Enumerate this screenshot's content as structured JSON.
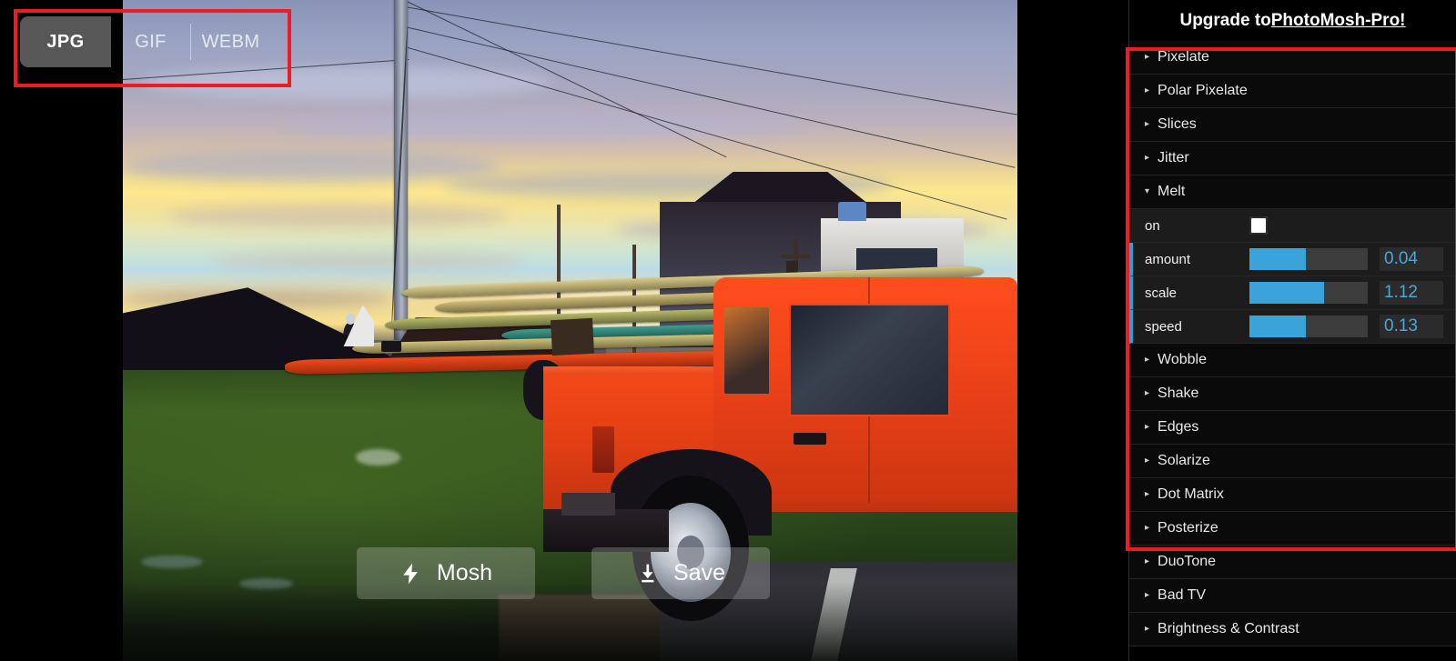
{
  "format_tabs": {
    "items": [
      {
        "label": "JPG",
        "active": true
      },
      {
        "label": "GIF",
        "active": false
      },
      {
        "label": "WEBM",
        "active": false
      }
    ]
  },
  "actions": {
    "mosh": {
      "label": "Mosh",
      "icon": "lightning-bolt-icon"
    },
    "save": {
      "label": "Save",
      "icon": "download-icon"
    }
  },
  "panel": {
    "header": {
      "prefix": "Upgrade to ",
      "product": "PhotoMosh-Pro!"
    },
    "effects": [
      {
        "label": "Pixelate",
        "expanded": false
      },
      {
        "label": "Polar Pixelate",
        "expanded": false
      },
      {
        "label": "Slices",
        "expanded": false
      },
      {
        "label": "Jitter",
        "expanded": false
      },
      {
        "label": "Melt",
        "expanded": true
      },
      {
        "label": "Wobble",
        "expanded": false
      },
      {
        "label": "Shake",
        "expanded": false
      },
      {
        "label": "Edges",
        "expanded": false
      },
      {
        "label": "Solarize",
        "expanded": false
      },
      {
        "label": "Dot Matrix",
        "expanded": false
      },
      {
        "label": "Posterize",
        "expanded": false
      },
      {
        "label": "DuoTone",
        "expanded": false
      },
      {
        "label": "Bad TV",
        "expanded": false
      },
      {
        "label": "Brightness & Contrast",
        "expanded": false
      }
    ],
    "melt_controls": {
      "toggle": {
        "label": "on",
        "checked": false
      },
      "sliders": [
        {
          "label": "amount",
          "value": "0.04",
          "fill_pct": 48
        },
        {
          "label": "scale",
          "value": "1.12",
          "fill_pct": 63
        },
        {
          "label": "speed",
          "value": "0.13",
          "fill_pct": 48
        }
      ]
    }
  },
  "colors": {
    "highlight": "#ed1c24",
    "slider_fill": "#3aa3d9",
    "value_text": "#4aa8d8",
    "panel_bg": "#000000"
  },
  "carets": {
    "collapsed": "▸",
    "expanded": "▾"
  }
}
